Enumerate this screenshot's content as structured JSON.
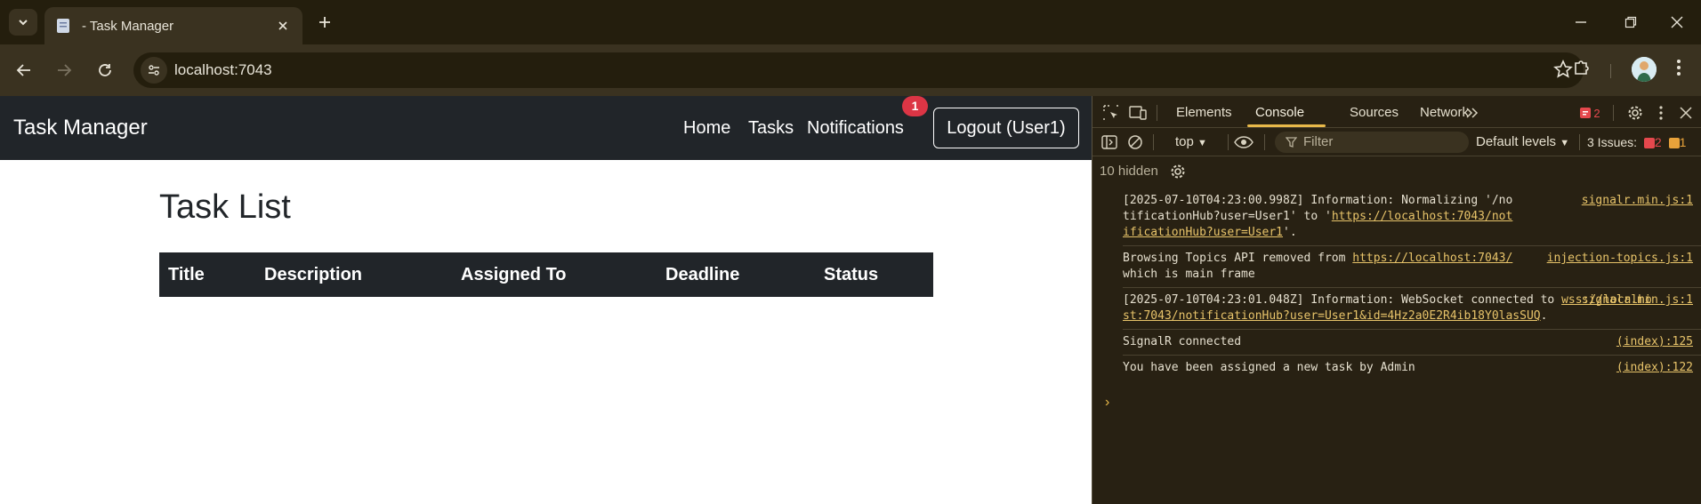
{
  "browser": {
    "tab_title": "- Task Manager",
    "url": "localhost:7043"
  },
  "page": {
    "brand": "Task Manager",
    "nav": [
      {
        "label": "Home"
      },
      {
        "label": "Tasks"
      },
      {
        "label": "Notifications"
      }
    ],
    "notification_badge": "1",
    "logout_label": "Logout (User1)",
    "title": "Task List",
    "table_headers": [
      "Title",
      "Description",
      "Assigned To",
      "Deadline",
      "Status"
    ]
  },
  "devtools": {
    "tabs": [
      {
        "label": "Elements"
      },
      {
        "label": "Console"
      },
      {
        "label": "Sources"
      },
      {
        "label": "Network"
      }
    ],
    "error_count": "2",
    "context": "top",
    "filter_placeholder": "Filter",
    "levels": "Default levels",
    "issues_label": "3 Issues:",
    "issues_errors": "2",
    "issues_warnings": "1",
    "hidden": "10 hidden",
    "logs": [
      {
        "text": "[2025-07-10T04:23:00.998Z] Information: Normalizing '/notificationHub?user=User1' to '",
        "link": "https://localhost:7043/notificationHub?user=User1",
        "suffix": "'.",
        "source": "signalr.min.js:1"
      },
      {
        "text": "Browsing Topics API removed from ",
        "link": "https://localhost:7043/",
        "suffix": " which is main frame",
        "source": "injection-topics.js:1"
      },
      {
        "text": "[2025-07-10T04:23:01.048Z] Information: WebSocket connected to ",
        "link": "wss://localhost:7043/notificationHub?user=User1&id=4Hz2a0E2R4ib18Y0lasSUQ",
        "suffix": ".",
        "source": "signalr.min.js:1"
      },
      {
        "text": "SignalR connected",
        "link": "",
        "suffix": "",
        "source": "(index):125"
      },
      {
        "text": "You have been assigned a new task by Admin",
        "link": "",
        "suffix": "",
        "source": "(index):122"
      }
    ]
  },
  "colors": {
    "navbar": "#212529",
    "badge": "#dc3545",
    "devtools_bg": "#282113",
    "chrome_bg": "#3a3220",
    "accent": "#e8b94a"
  }
}
